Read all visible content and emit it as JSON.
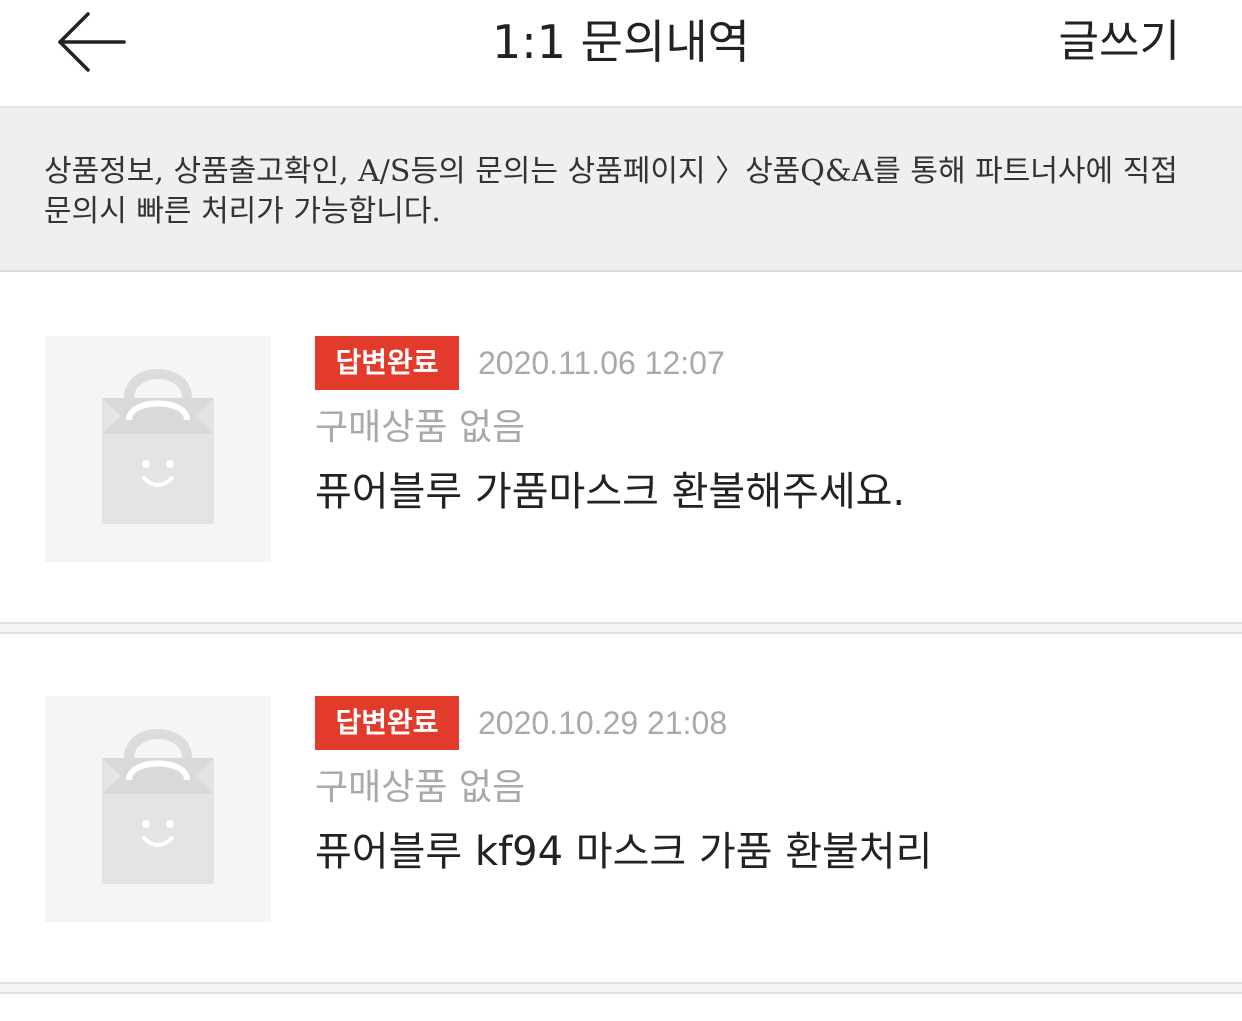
{
  "header": {
    "title": "1:1 문의내역",
    "write_label": "글쓰기",
    "back_icon": "arrow-left-icon"
  },
  "notice": {
    "text": "상품정보, 상품출고확인, A/S등의 문의는 상품페이지 〉상품Q&A를 통해 파트너사에 직접 문의시 빠른 처리가 가능합니다."
  },
  "inquiries": [
    {
      "status": "답변완료",
      "date": "2020.11.06 12:07",
      "product": "구매상품 없음",
      "subject": "퓨어블루 가품마스크 환불해주세요.",
      "thumbnail_icon": "shopping-bag-icon"
    },
    {
      "status": "답변완료",
      "date": "2020.10.29 21:08",
      "product": "구매상품 없음",
      "subject": "퓨어블루 kf94 마스크 가품 환불처리",
      "thumbnail_icon": "shopping-bag-icon"
    }
  ],
  "colors": {
    "badge": "#e23a2b",
    "muted_text": "#a9a9a9",
    "notice_bg": "#efefef"
  }
}
